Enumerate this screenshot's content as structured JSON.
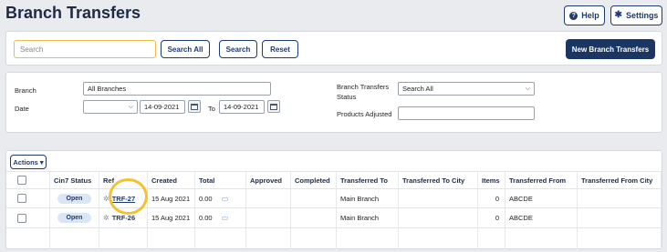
{
  "page": {
    "title": "Branch Transfers"
  },
  "header_buttons": {
    "help": "Help",
    "settings": "Settings"
  },
  "search": {
    "placeholder": "Search",
    "search_all": "Search All",
    "search": "Search",
    "reset": "Reset",
    "new_button": "New Branch Transfers"
  },
  "filters": {
    "branch_label": "Branch",
    "branch_value": "All Branches",
    "date_label": "Date",
    "date_from": "14-09-2021",
    "to_label": "To",
    "date_to": "14-09-2021",
    "status_label_line1": "Branch Transfers",
    "status_label_line2": "Status",
    "status_value": "Search All",
    "products_adjusted_label": "Products Adjusted",
    "products_adjusted_value": ""
  },
  "table": {
    "actions_label": "Actions ▾",
    "headers": [
      "Cin7 Status",
      "Ref",
      "Created",
      "Total",
      "Approved",
      "Completed",
      "Transferred To",
      "Transferred To City",
      "Items",
      "Transferred From",
      "Transferred From City"
    ],
    "rows": [
      {
        "status": "Open",
        "ref": "TRF-27",
        "created": "15 Aug 2021",
        "total": "0.00",
        "approved": "",
        "completed": "",
        "to": "Main Branch",
        "to_city": "",
        "items": "0",
        "from": "ABCDE",
        "from_city": ""
      },
      {
        "status": "Open",
        "ref": "TRF-26",
        "created": "15 Aug 2021",
        "total": "0.00",
        "approved": "",
        "completed": "",
        "to": "Main Branch",
        "to_city": "",
        "items": "0",
        "from": "ABCDE",
        "from_city": ""
      }
    ]
  },
  "colors": {
    "primary": "#1c3664",
    "accent_highlight": "#f2c230",
    "background": "#e9ebee"
  }
}
